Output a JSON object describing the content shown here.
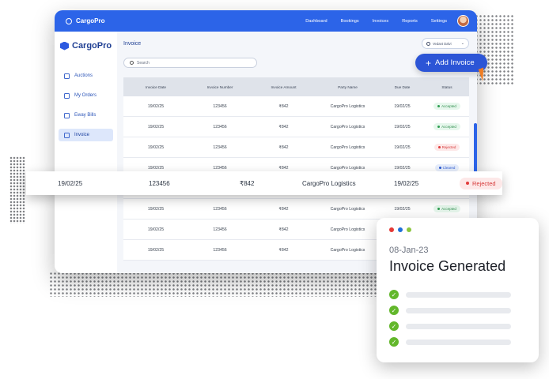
{
  "topnav": {
    "brand": "CargoPro",
    "links": [
      "Dashboard",
      "Bookings",
      "Invoices",
      "Reports",
      "Settings"
    ]
  },
  "sidebar": {
    "brand": "CargoPro",
    "items": [
      {
        "label": "Auctions",
        "icon": "hammer-icon"
      },
      {
        "label": "My Orders",
        "icon": "orders-icon"
      },
      {
        "label": "Eway Bills",
        "icon": "document-icon"
      },
      {
        "label": "Invoice",
        "icon": "invoice-icon",
        "active": true
      }
    ]
  },
  "main": {
    "title": "Invoice",
    "user_name": "Vedant Dalvi",
    "search_placeholder": "Search",
    "add_button": "Add Invoice",
    "columns": [
      "Invoice Date",
      "Invoice Number",
      "Invoice Amount",
      "Party Name",
      "Due Date",
      "Status"
    ],
    "rows": [
      {
        "date": "19/02/25",
        "number": "123456",
        "amount": "₹842",
        "party": "CargoPro Logistics",
        "due": "19/02/25",
        "status": "Accepted"
      },
      {
        "date": "19/02/25",
        "number": "123456",
        "amount": "₹842",
        "party": "CargoPro Logistics",
        "due": "19/02/25",
        "status": "Accepted"
      },
      {
        "date": "19/02/25",
        "number": "123456",
        "amount": "₹842",
        "party": "CargoPro Logistics",
        "due": "19/02/25",
        "status": "Rejected"
      },
      {
        "date": "19/02/25",
        "number": "123456",
        "amount": "₹842",
        "party": "CargoPro Logistics",
        "due": "19/02/25",
        "status": "Cleared"
      },
      {
        "date": "19/02/25",
        "number": "123456",
        "amount": "₹842",
        "party": "CargoPro Logistics",
        "due": "19/02/25",
        "status": "Rejected"
      },
      {
        "date": "19/02/25",
        "number": "123456",
        "amount": "₹842",
        "party": "CargoPro Logistics",
        "due": "19/02/25",
        "status": "Accepted"
      },
      {
        "date": "19/02/25",
        "number": "123456",
        "amount": "₹842",
        "party": "CargoPro Logistics",
        "due": "19/02/25",
        "status": ""
      },
      {
        "date": "19/02/25",
        "number": "123456",
        "amount": "₹842",
        "party": "CargoPro Logistics",
        "due": "19/02/25",
        "status": ""
      }
    ]
  },
  "highlight_row": {
    "date": "19/02/25",
    "number": "123456",
    "amount": "₹842",
    "party": "CargoPro Logistics",
    "due": "19/02/25",
    "status": "Rejected"
  },
  "card": {
    "date": "08-Jan-23",
    "title": "Invoice Generated",
    "traffic_colors": [
      "#e53935",
      "#1e6fd9",
      "#8cc63f"
    ],
    "check_count": 4
  },
  "colors": {
    "primary": "#2c64e8",
    "accepted": "#2f9e52",
    "rejected": "#e23b3b",
    "cleared": "#2b59d2"
  }
}
